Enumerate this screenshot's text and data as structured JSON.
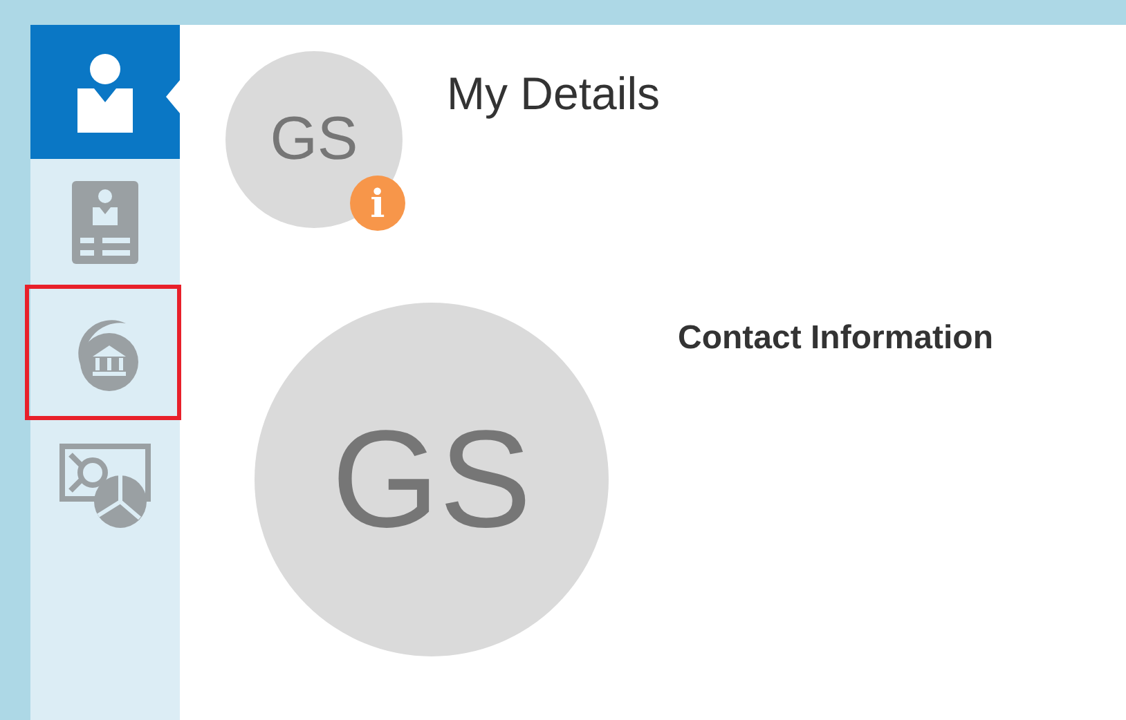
{
  "sidebar": {
    "items": [
      {
        "kind": "profile",
        "selected": true,
        "highlighted": false
      },
      {
        "kind": "badge",
        "selected": false,
        "highlighted": false
      },
      {
        "kind": "bank",
        "selected": false,
        "highlighted": true
      },
      {
        "kind": "compensation",
        "selected": false,
        "highlighted": false
      }
    ]
  },
  "header": {
    "avatar_initials": "GS",
    "badge": "i",
    "title": "My Details"
  },
  "profile": {
    "avatar_initials": "GS",
    "section_title": "Contact Information"
  }
}
